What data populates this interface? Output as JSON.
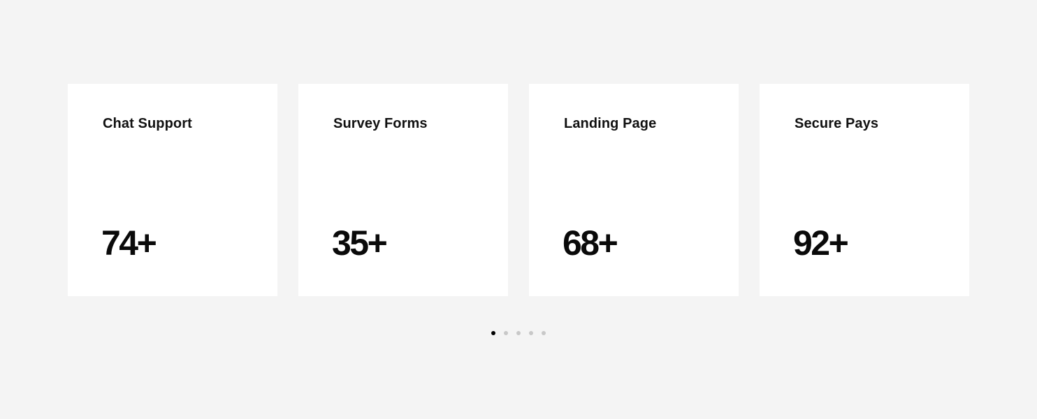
{
  "cards": [
    {
      "title": "Chat Support",
      "value": "74+"
    },
    {
      "title": "Survey Forms",
      "value": "35+"
    },
    {
      "title": "Landing Page",
      "value": "68+"
    },
    {
      "title": "Secure Pays",
      "value": "92+"
    }
  ],
  "pagination": {
    "count": 5,
    "active_index": 0,
    "active_color": "#000000",
    "inactive_color": "#c8c8c8"
  },
  "colors": {
    "background": "#f4f4f4",
    "card": "#ffffff"
  }
}
